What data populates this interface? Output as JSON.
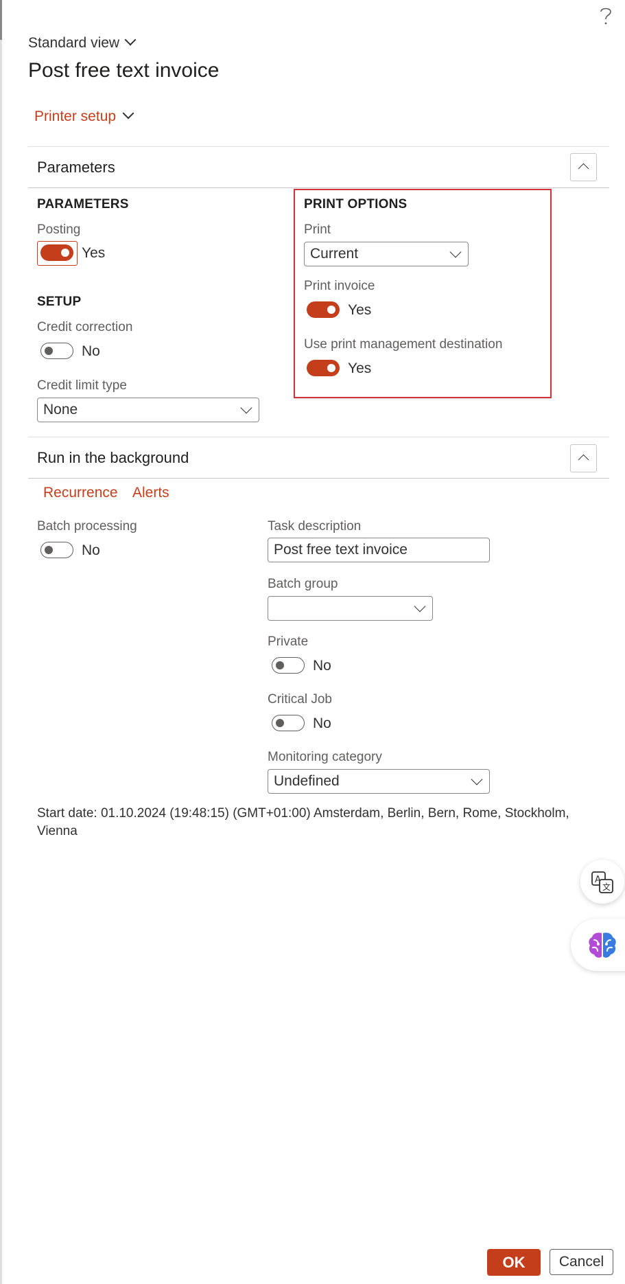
{
  "header": {
    "help_icon": "question-mark",
    "view_label": "Standard view",
    "title": "Post free text invoice",
    "printer_setup": "Printer setup"
  },
  "parameters_section": {
    "title": "Parameters",
    "parameters_group": {
      "heading": "PARAMETERS",
      "posting": {
        "label": "Posting",
        "value": "Yes",
        "on": true
      }
    },
    "setup_group": {
      "heading": "SETUP",
      "credit_correction": {
        "label": "Credit correction",
        "value": "No",
        "on": false
      },
      "credit_limit_type": {
        "label": "Credit limit type",
        "value": "None"
      }
    },
    "print_options_group": {
      "heading": "PRINT OPTIONS",
      "print": {
        "label": "Print",
        "value": "Current"
      },
      "print_invoice": {
        "label": "Print invoice",
        "value": "Yes",
        "on": true
      },
      "use_print_mgmt": {
        "label": "Use print management destination",
        "value": "Yes",
        "on": true
      }
    }
  },
  "background_section": {
    "title": "Run in the background",
    "links": [
      "Recurrence",
      "Alerts"
    ],
    "batch_processing": {
      "label": "Batch processing",
      "value": "No",
      "on": false
    },
    "task_description": {
      "label": "Task description",
      "value": "Post free text invoice"
    },
    "batch_group": {
      "label": "Batch group",
      "value": ""
    },
    "private": {
      "label": "Private",
      "value": "No",
      "on": false
    },
    "critical_job": {
      "label": "Critical Job",
      "value": "No",
      "on": false
    },
    "monitoring_category": {
      "label": "Monitoring category",
      "value": "Undefined"
    },
    "start_date": "Start date: 01.10.2024 (19:48:15) (GMT+01:00) Amsterdam, Berlin, Bern, Rome, Stockholm, Vienna"
  },
  "side_buttons": [
    "translate-icon",
    "copilot-brain-icon"
  ],
  "footer": {
    "ok": "OK",
    "cancel": "Cancel"
  },
  "colors": {
    "accent": "#c43e1c",
    "highlight_border": "#d13438"
  }
}
